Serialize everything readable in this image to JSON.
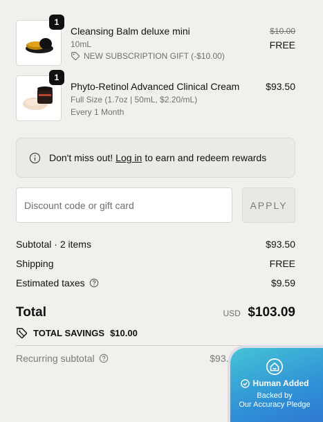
{
  "items": [
    {
      "name": "Cleansing Balm deluxe mini",
      "quantity": "1",
      "size": "10mL",
      "gift_label": "NEW SUBSCRIPTION GIFT (-$10.00)",
      "original_price": "$10.00",
      "price": "FREE"
    },
    {
      "name": "Phyto-Retinol Advanced Clinical Cream",
      "quantity": "1",
      "size": "Full Size (1.7oz | 50mL, $2.20/mL)",
      "frequency": "Every 1 Month",
      "price": "$93.50"
    }
  ],
  "rewards": {
    "prefix": "Don't miss out!",
    "link": "Log in",
    "suffix": "to earn and redeem rewards"
  },
  "discount": {
    "placeholder": "Discount code or gift card",
    "apply_label": "APPLY"
  },
  "summary": {
    "subtotal_label": "Subtotal · 2 items",
    "subtotal_value": "$93.50",
    "shipping_label": "Shipping",
    "shipping_value": "FREE",
    "taxes_label": "Estimated taxes",
    "taxes_value": "$9.59",
    "total_label": "Total",
    "currency": "USD",
    "total_value": "$103.09",
    "savings_label": "TOTAL SAVINGS",
    "savings_value": "$10.00",
    "recurring_label": "Recurring subtotal",
    "recurring_value": "$93.50 every month"
  },
  "badge": {
    "title": "Human Added",
    "line1": "Backed by",
    "line2": "Our Accuracy Pledge"
  },
  "colors": {
    "background": "#f1f0ec",
    "badge_start": "#45c3d6",
    "badge_end": "#2f6fd0",
    "quantity_badge": "#111111"
  }
}
